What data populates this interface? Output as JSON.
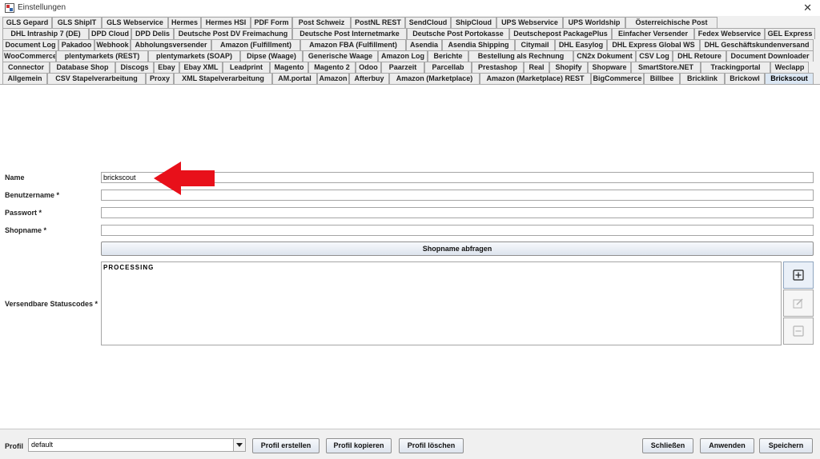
{
  "window": {
    "title": "Einstellungen",
    "close_symbol": "✕"
  },
  "tab_rows": [
    [
      "GLS Gepard",
      "GLS ShipIT",
      "GLS Webservice",
      "Hermes",
      "Hermes HSI",
      "PDF Form",
      "Post Schweiz",
      "PostNL REST",
      "SendCloud",
      "ShipCloud",
      "UPS Webservice",
      "UPS Worldship",
      "Österreichische Post"
    ],
    [
      "DHL Intraship 7 (DE)",
      "DPD Cloud",
      "DPD Delis",
      "Deutsche Post DV Freimachung",
      "Deutsche Post Internetmarke",
      "Deutsche Post Portokasse",
      "Deutschepost PackagePlus",
      "Einfacher Versender",
      "Fedex Webservice",
      "GEL Express"
    ],
    [
      "Document Log",
      "Pakadoo",
      "Webhook",
      "Abholungsversender",
      "Amazon (Fulfillment)",
      "Amazon FBA (Fulfillment)",
      "Asendia",
      "Asendia Shipping",
      "Citymail",
      "DHL Easylog",
      "DHL Express Global WS",
      "DHL Geschäftskundenversand"
    ],
    [
      "WooCommerce",
      "plentymarkets (REST)",
      "plentymarkets (SOAP)",
      "Dipse (Waage)",
      "Generische Waage",
      "Amazon Log",
      "Berichte",
      "Bestellung als Rechnung",
      "CN2x Dokument",
      "CSV Log",
      "DHL Retoure",
      "Document Downloader"
    ],
    [
      "Connector",
      "Database Shop",
      "Discogs",
      "Ebay",
      "Ebay XML",
      "Leadprint",
      "Magento",
      "Magento 2",
      "Odoo",
      "Paarzeit",
      "Parcellab",
      "Prestashop",
      "Real",
      "Shopify",
      "Shopware",
      "SmartStore.NET",
      "Trackingportal",
      "Weclapp"
    ],
    [
      "Allgemein",
      "CSV Stapelverarbeitung",
      "Proxy",
      "XML Stapelverarbeitung",
      "AM.portal",
      "Amazon",
      "Afterbuy",
      "Amazon (Marketplace)",
      "Amazon (Marketplace) REST",
      "BigCommerce",
      "Billbee",
      "Bricklink",
      "Brickowl",
      "Brickscout"
    ]
  ],
  "active_tab": "Brickscout",
  "form": {
    "name_label": "Name",
    "name_value": "brickscout",
    "username_label": "Benutzername *",
    "username_value": "",
    "password_label": "Passwort *",
    "password_value": "",
    "shopname_label": "Shopname *",
    "shopname_value": "",
    "fetch_shopname_button": "Shopname abfragen",
    "status_codes_label": "Versendbare Statuscodes *",
    "status_codes": [
      "PROCESSING"
    ]
  },
  "icons": {
    "add": "add-square-icon",
    "edit": "edit-icon",
    "remove": "remove-square-icon",
    "arrow": "red-arrow-icon",
    "app": "app-icon"
  },
  "colors": {
    "arrow": "#e8101a",
    "active_tab": "#dbe7f4"
  },
  "bottom": {
    "profile_label": "Profil",
    "profile_value": "default",
    "create_profile": "Profil erstellen",
    "copy_profile": "Profil kopieren",
    "delete_profile": "Profil löschen",
    "close": "Schließen",
    "apply": "Anwenden",
    "save": "Speichern"
  }
}
